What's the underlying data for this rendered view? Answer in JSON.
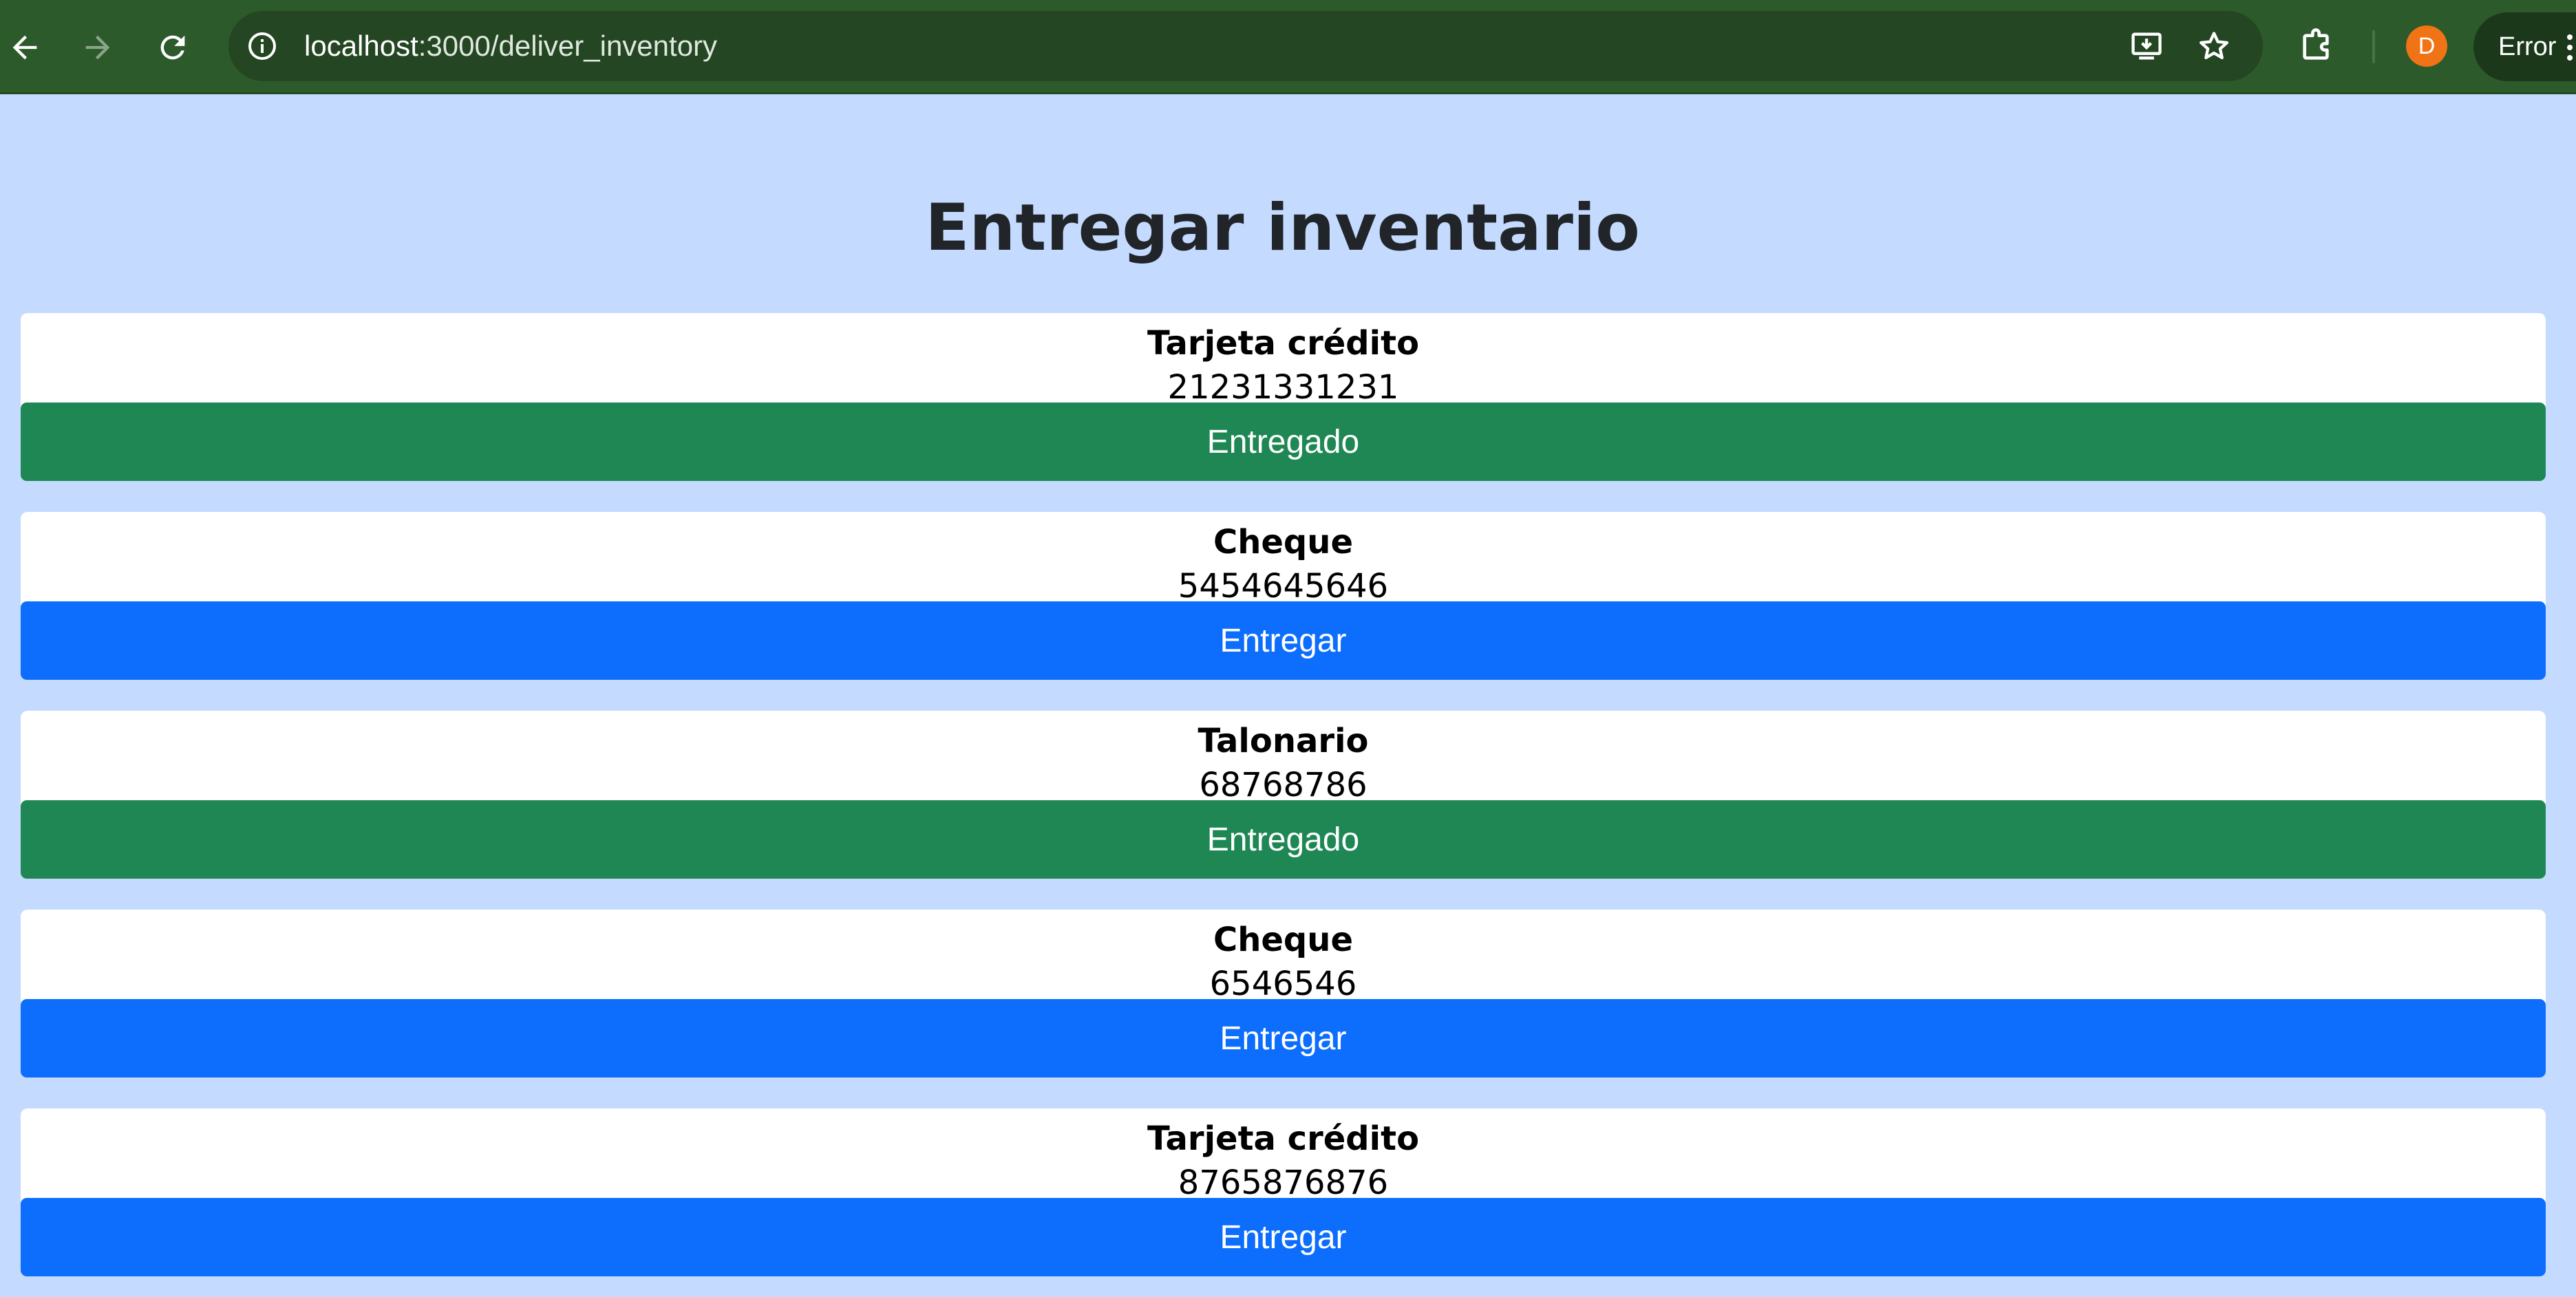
{
  "browser": {
    "url_host": "localhost",
    "url_path": ":3000/deliver_inventory",
    "profile_initial": "D",
    "error_label": "Error",
    "icons": {
      "back": "arrow-left-icon",
      "forward": "arrow-right-icon",
      "reload": "reload-icon",
      "site_info": "info-icon",
      "install": "install-app-icon",
      "bookmark": "star-icon",
      "extensions": "puzzle-icon",
      "menu": "more-vert-icon"
    },
    "colors": {
      "toolbar": "#2c5a2b",
      "omnibox": "#244622",
      "avatar": "#f07316"
    }
  },
  "page": {
    "title": "Entregar inventario",
    "background": "#c4dbff",
    "items": [
      {
        "name": "Tarjeta crédito",
        "number": "21231331231",
        "action": "Entregado",
        "status": "delivered"
      },
      {
        "name": "Cheque",
        "number": "5454645646",
        "action": "Entregar",
        "status": "pending"
      },
      {
        "name": "Talonario",
        "number": "68768786",
        "action": "Entregado",
        "status": "delivered"
      },
      {
        "name": "Cheque",
        "number": "6546546",
        "action": "Entregar",
        "status": "pending"
      },
      {
        "name": "Tarjeta crédito",
        "number": "8765876876",
        "action": "Entregar",
        "status": "pending"
      }
    ],
    "colors": {
      "delivered": "#1e8754",
      "pending": "#0d6efd"
    }
  }
}
